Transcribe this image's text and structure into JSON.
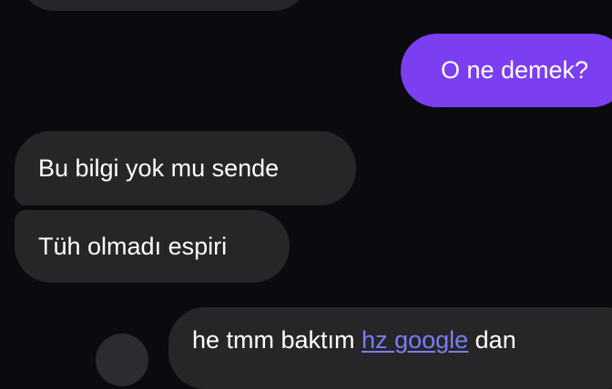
{
  "conversation": {
    "messages": [
      {
        "id": "msg-o-ne-demek",
        "direction": "outgoing",
        "text": "O ne demek?"
      },
      {
        "id": "msg-bu-bilgi",
        "direction": "incoming",
        "text": "Bu bilgi yok mu sende"
      },
      {
        "id": "msg-tuh",
        "direction": "incoming",
        "text": "Tüh olmadı espiri"
      },
      {
        "id": "msg-bottom",
        "direction": "incoming",
        "text_before": "he tmm baktım ",
        "link_text": "hz google",
        "text_after": " dan"
      }
    ]
  },
  "colors": {
    "background": "#0a0a0f",
    "incoming_bubble": "#262629",
    "outgoing_bubble": "#7b3ef0",
    "link": "#7c7cf2"
  }
}
